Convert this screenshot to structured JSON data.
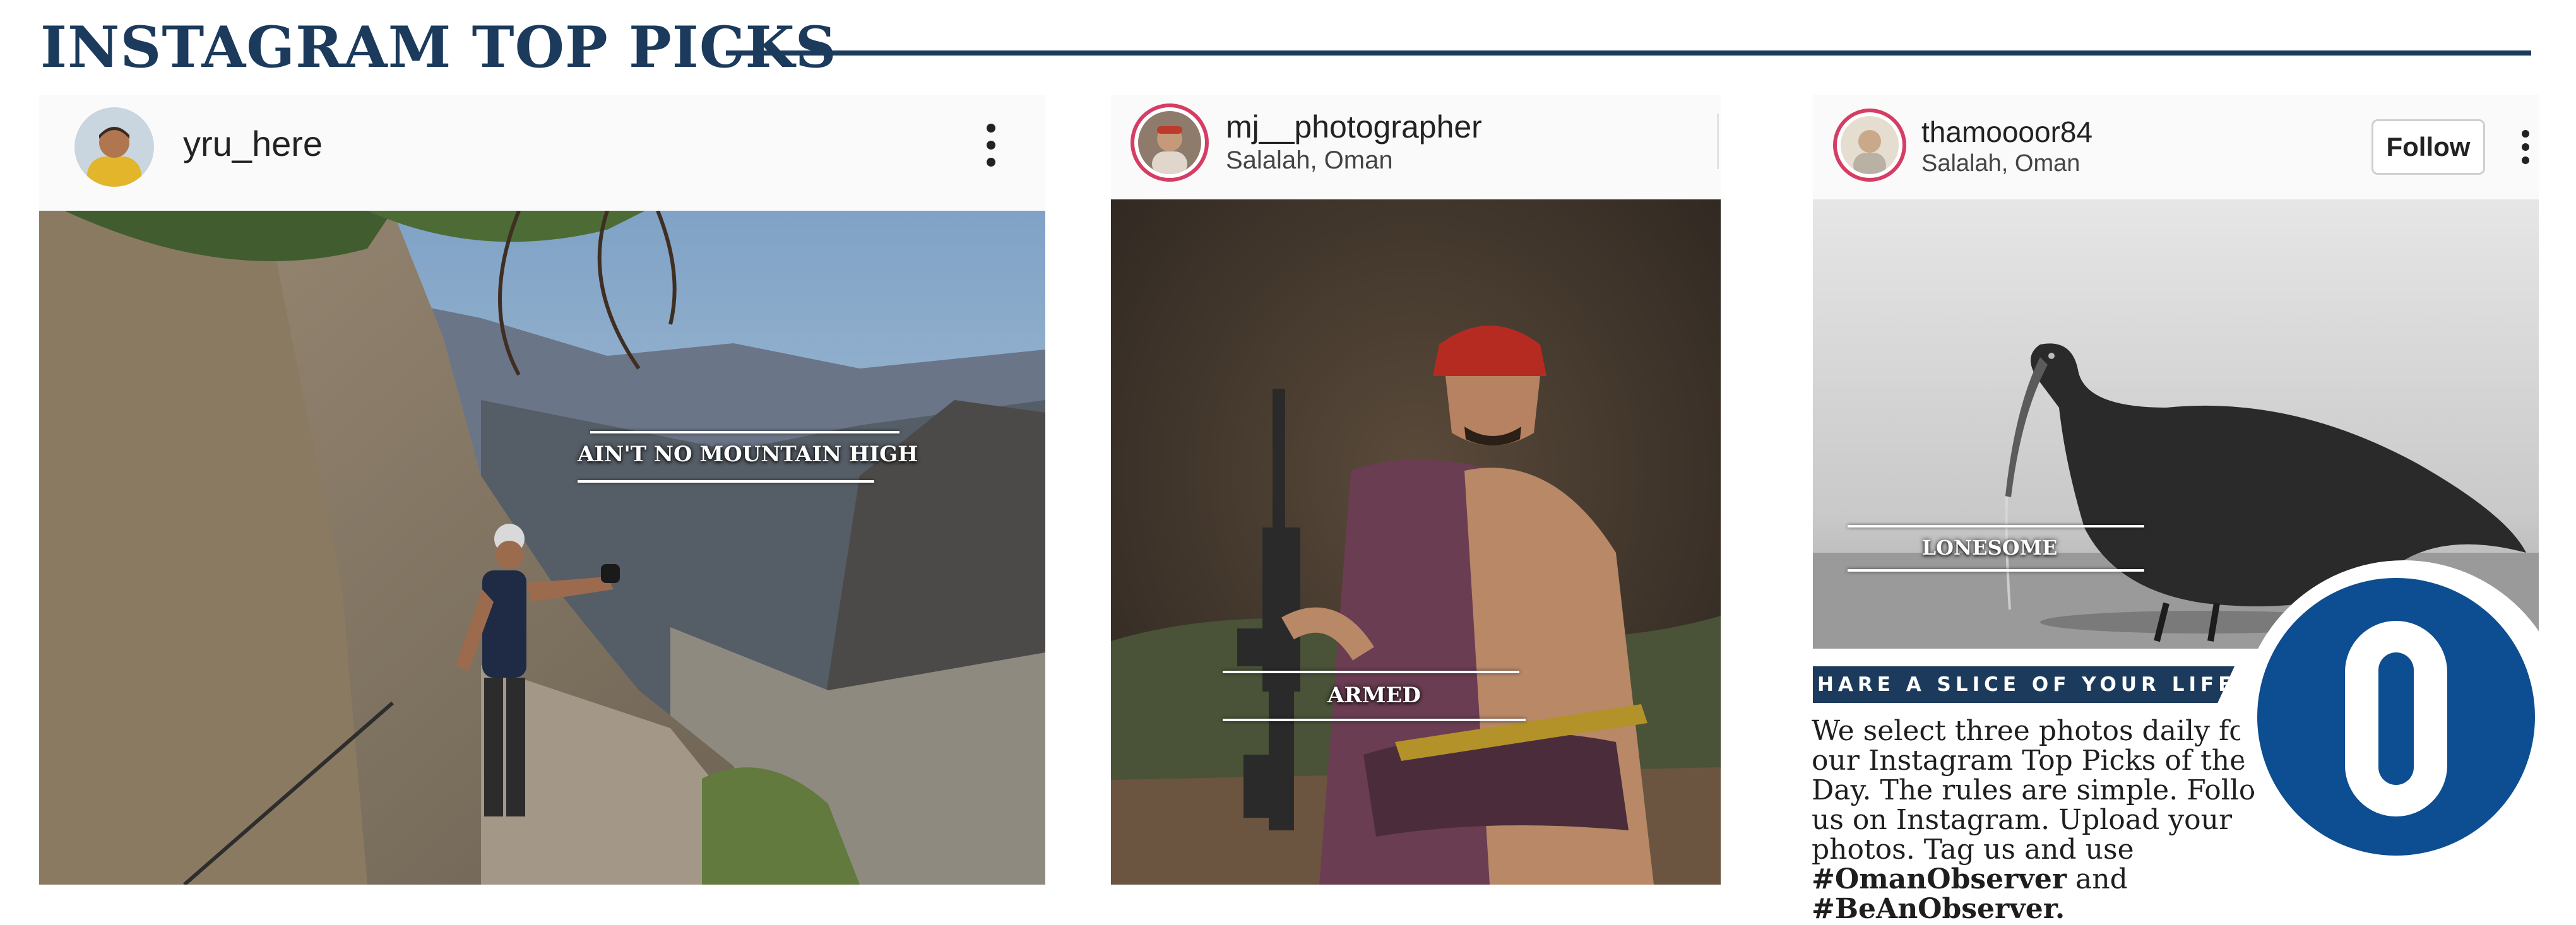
{
  "header": {
    "title": "INSTAGRAM TOP PICKS"
  },
  "colors": {
    "brand_navy": "#1b3a5c",
    "logo_blue": "#0d4d91",
    "story_ring": "#d63d64",
    "caption_white": "#ffffff"
  },
  "posts": [
    {
      "username": "yru_here",
      "location": "",
      "caption": "AIN'T NO MOUNTAIN HIGH",
      "menu_icon": "more-vertical-icon",
      "photo_subject": "hiker on a via ferrata cliff path in the mountains"
    },
    {
      "username": "mj__photographer",
      "location": "Salalah, Oman",
      "caption": "ARMED",
      "photo_subject": "man in red turban holding a rifle and khanjar"
    },
    {
      "username": "thamoooor84",
      "location": "Salalah, Oman",
      "caption": "LONESOME",
      "follow_label": "Follow",
      "menu_icon": "more-vertical-icon",
      "photo_subject": "black and white ibis drinking from water"
    }
  ],
  "promo": {
    "banner": "SHARE A SLICE OF YOUR LIFE",
    "body": "We select three photos daily for our Instagram Top Picks of the Day. The rules are simple. Follow us on Instagram. Upload your photos. Tag us and use",
    "hashtag_1": "#OmanObserver",
    "joiner": "and",
    "hashtag_2": "#BeAnObserver.",
    "logo_letter": "O"
  }
}
